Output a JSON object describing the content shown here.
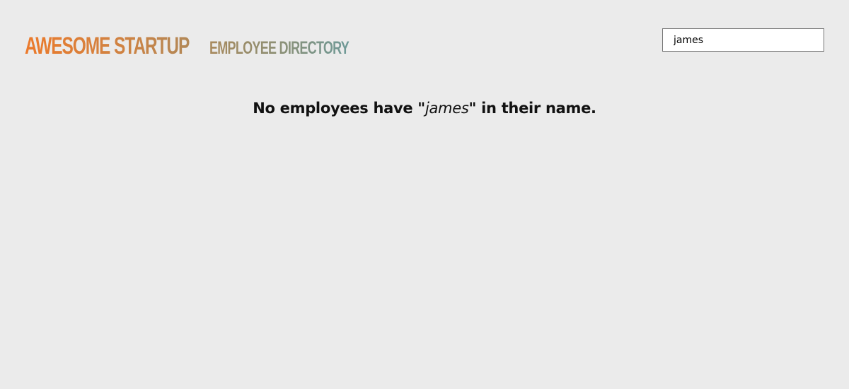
{
  "header": {
    "title_main": "Awesome Startup",
    "title_sub": "Employee Directory"
  },
  "search": {
    "value": "james"
  },
  "message": {
    "prefix": "No employees have \"",
    "term": "james",
    "suffix": "\" in their name."
  },
  "colors": {
    "background": "#ebebeb",
    "title_gradient_start": "#ec7a2b",
    "title_gradient_end": "#6f9a98"
  }
}
